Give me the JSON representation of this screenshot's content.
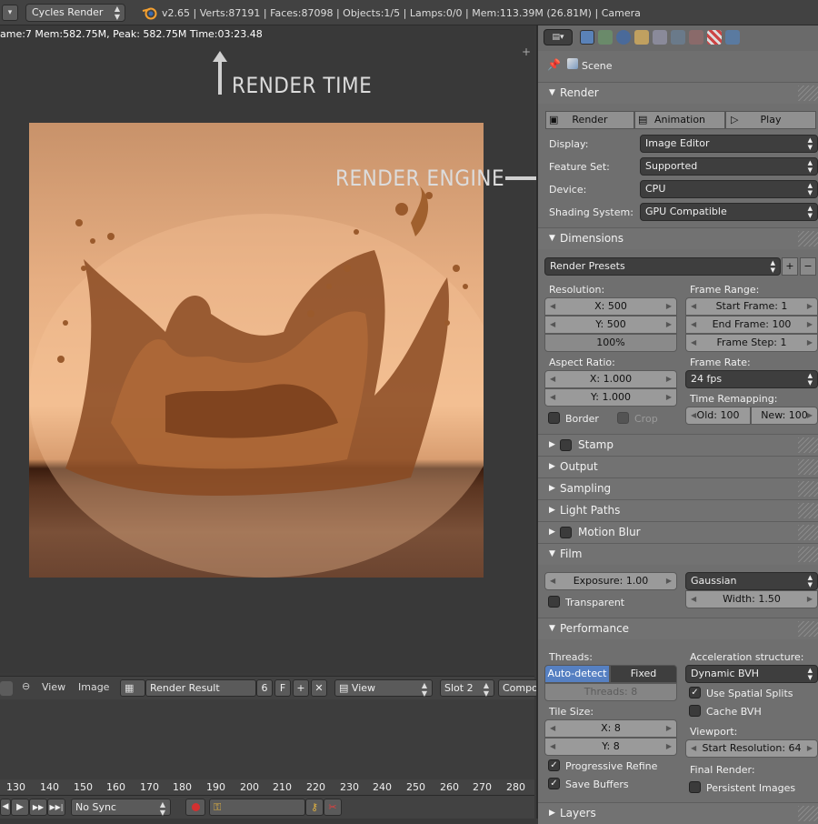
{
  "header": {
    "engine": "Cycles Render",
    "version": "v2.65",
    "verts": "Verts:87191",
    "faces": "Faces:87098",
    "objects": "Objects:1/5",
    "lamps": "Lamps:0/0",
    "mem": "Mem:113.39M (26.81M)",
    "camera": "Camera"
  },
  "viewer": {
    "render_info": "ame:7 Mem:582.75M, Peak: 582.75M Time:03:23.48",
    "annot_time": "RENDER TIME",
    "annot_engine": "RENDER ENGINE"
  },
  "image_header": {
    "view": "View",
    "image": "Image",
    "image_name": "Render Result",
    "users": "6",
    "fake": "F",
    "view_mode": "View",
    "slot": "Slot 2",
    "composite": "Compo"
  },
  "timeline": {
    "ticks": [
      "130",
      "140",
      "150",
      "160",
      "170",
      "180",
      "190",
      "200",
      "210",
      "220",
      "230",
      "240",
      "250",
      "260",
      "270",
      "280"
    ],
    "sync": "No Sync"
  },
  "props": {
    "scene": "Scene",
    "render": {
      "title": "Render",
      "render_btn": "Render",
      "animation_btn": "Animation",
      "play_btn": "Play",
      "display_label": "Display:",
      "display_value": "Image Editor",
      "feature_label": "Feature Set:",
      "feature_value": "Supported",
      "device_label": "Device:",
      "device_value": "CPU",
      "shading_label": "Shading System:",
      "shading_value": "GPU Compatible"
    },
    "dimensions": {
      "title": "Dimensions",
      "presets": "Render Presets",
      "resolution_label": "Resolution:",
      "res_x": "X: 500",
      "res_y": "Y: 500",
      "res_pct": "100%",
      "frame_range_label": "Frame Range:",
      "start": "Start Frame: 1",
      "end": "End Frame: 100",
      "step": "Frame Step: 1",
      "aspect_label": "Aspect Ratio:",
      "asp_x": "X: 1.000",
      "asp_y": "Y: 1.000",
      "frame_rate_label": "Frame Rate:",
      "fps": "24 fps",
      "remap_label": "Time Remapping:",
      "old": "Old: 100",
      "new": "New: 100",
      "border": "Border",
      "crop": "Crop"
    },
    "stamp": "Stamp",
    "output": "Output",
    "sampling": "Sampling",
    "light_paths": "Light Paths",
    "motion_blur": "Motion Blur",
    "film": {
      "title": "Film",
      "exposure": "Exposure: 1.00",
      "filter": "Gaussian",
      "transparent": "Transparent",
      "width": "Width: 1.50"
    },
    "performance": {
      "title": "Performance",
      "threads_label": "Threads:",
      "auto": "Auto-detect",
      "fixed": "Fixed",
      "threads": "Threads: 8",
      "tile_label": "Tile Size:",
      "tile_x": "X: 8",
      "tile_y": "Y: 8",
      "progressive": "Progressive Refine",
      "save_buffers": "Save Buffers",
      "accel_label": "Acceleration structure:",
      "accel_value": "Dynamic BVH",
      "spatial": "Use Spatial Splits",
      "cache": "Cache BVH",
      "viewport_label": "Viewport:",
      "start_res": "Start Resolution: 64",
      "final_label": "Final Render:",
      "persistent": "Persistent Images"
    },
    "layers": "Layers"
  }
}
